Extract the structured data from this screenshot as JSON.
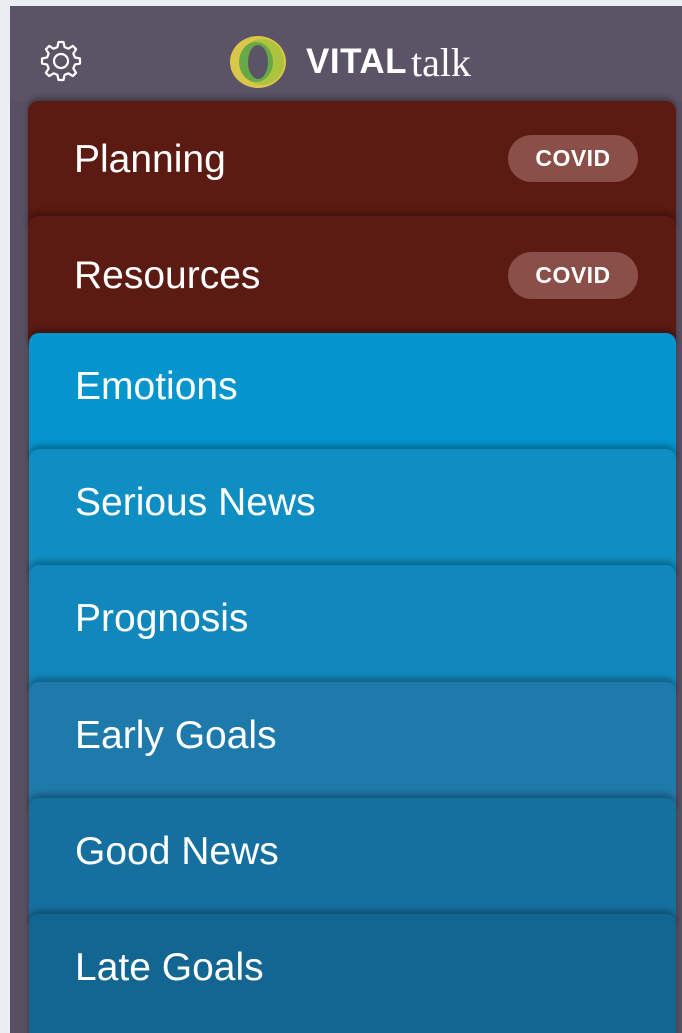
{
  "header": {
    "brand_bold": "VITAL",
    "brand_light": "talk",
    "settings_icon": "gear-icon",
    "logo_icon": "vitaltalk-ring-logo",
    "logo_colors": [
      "#d9c64a",
      "#a9c23c",
      "#5aa548"
    ]
  },
  "menu": {
    "covid_items": [
      {
        "label": "Planning",
        "badge": "COVID"
      },
      {
        "label": "Resources",
        "badge": "COVID"
      }
    ],
    "items": [
      {
        "label": "Emotions"
      },
      {
        "label": "Serious News"
      },
      {
        "label": "Prognosis"
      },
      {
        "label": "Early Goals"
      },
      {
        "label": "Good News"
      },
      {
        "label": "Late Goals"
      }
    ]
  },
  "colors": {
    "header_bg": "#5b5467",
    "covid_row": "#5b1a12",
    "covid_badge": "#8a4f48",
    "blue_rows": [
      "#0495cf",
      "#0f8ec3",
      "#1287bb",
      "#1e7aaa",
      "#15709f",
      "#136592"
    ]
  }
}
